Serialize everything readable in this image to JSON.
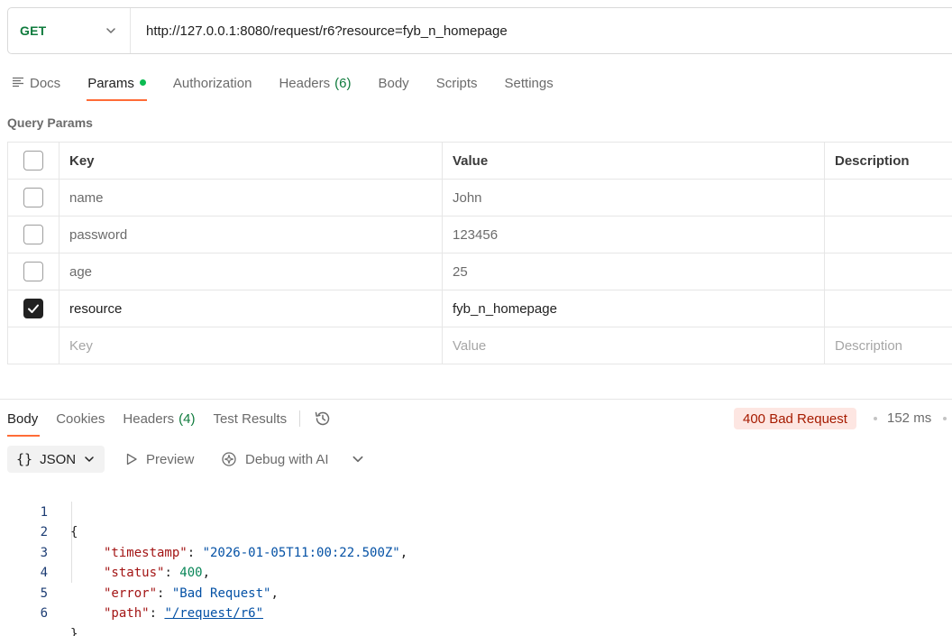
{
  "request": {
    "method": "GET",
    "url": "http://127.0.0.1:8080/request/r6?resource=fyb_n_homepage"
  },
  "request_tabs": {
    "docs": "Docs",
    "params": "Params",
    "authorization": "Authorization",
    "headers": "Headers",
    "headers_count": "(6)",
    "body": "Body",
    "scripts": "Scripts",
    "settings": "Settings"
  },
  "query_params": {
    "title": "Query Params",
    "headers": {
      "key": "Key",
      "value": "Value",
      "description": "Description"
    },
    "rows": [
      {
        "key": "name",
        "value": "John",
        "description": "",
        "enabled": false
      },
      {
        "key": "password",
        "value": "123456",
        "description": "",
        "enabled": false
      },
      {
        "key": "age",
        "value": "25",
        "description": "",
        "enabled": false
      },
      {
        "key": "resource",
        "value": "fyb_n_homepage",
        "description": "",
        "enabled": true
      }
    ],
    "placeholder": {
      "key": "Key",
      "value": "Value",
      "description": "Description"
    }
  },
  "response_tabs": {
    "body": "Body",
    "cookies": "Cookies",
    "headers": "Headers",
    "headers_count": "(4)",
    "test_results": "Test Results"
  },
  "response_status": {
    "status": "400 Bad Request",
    "time": "152 ms",
    "status_color": "#a61b00",
    "status_bg": "#fde6e2"
  },
  "response_toolbar": {
    "format_icon": "{}",
    "format": "JSON",
    "preview": "Preview",
    "debug": "Debug with AI"
  },
  "response_body": {
    "line_numbers": [
      "1",
      "2",
      "3",
      "4",
      "5",
      "6"
    ],
    "open_brace": "{",
    "close_brace": "}",
    "fields": [
      {
        "key": "\"timestamp\"",
        "value": "\"2026-01-05T11:00:22.500Z\"",
        "suffix": ","
      },
      {
        "key": "\"status\"",
        "value": "400",
        "suffix": ","
      },
      {
        "key": "\"error\"",
        "value": "\"Bad Request\"",
        "suffix": ","
      },
      {
        "key": "\"path\"",
        "value": "\"/request/r6\"",
        "suffix": ""
      }
    ]
  },
  "colors": {
    "accent": "#ff6c37",
    "method_green": "#0f7b3d",
    "dot_green": "#0cbb52"
  }
}
